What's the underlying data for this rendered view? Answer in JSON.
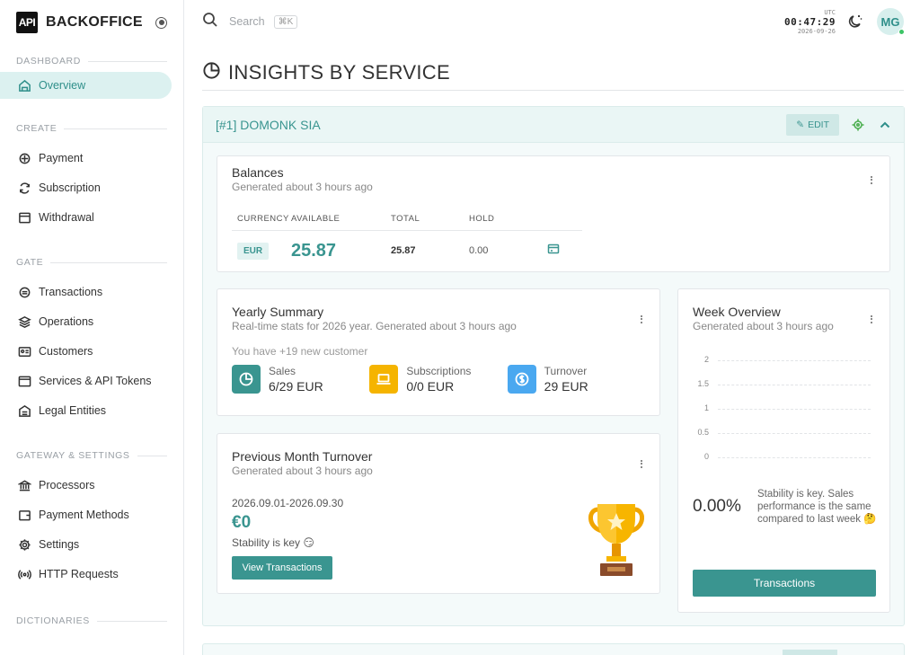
{
  "brand": {
    "logo": "API",
    "name": "BACKOFFICE"
  },
  "sidebar": {
    "sections": [
      {
        "label": "DASHBOARD",
        "items": [
          {
            "label": "Overview",
            "icon": "home-icon",
            "active": true
          }
        ]
      },
      {
        "label": "CREATE",
        "items": [
          {
            "label": "Payment",
            "icon": "payment-icon"
          },
          {
            "label": "Subscription",
            "icon": "refresh-icon"
          },
          {
            "label": "Withdrawal",
            "icon": "withdrawal-icon"
          }
        ]
      },
      {
        "label": "GATE",
        "items": [
          {
            "label": "Transactions",
            "icon": "transactions-icon"
          },
          {
            "label": "Operations",
            "icon": "layers-icon"
          },
          {
            "label": "Customers",
            "icon": "id-card-icon"
          },
          {
            "label": "Services & API Tokens",
            "icon": "browser-icon"
          },
          {
            "label": "Legal Entities",
            "icon": "building-icon"
          }
        ]
      },
      {
        "label": "GATEWAY & SETTINGS",
        "items": [
          {
            "label": "Processors",
            "icon": "bank-icon"
          },
          {
            "label": "Payment Methods",
            "icon": "wallet-icon"
          },
          {
            "label": "Settings",
            "icon": "gear-icon"
          },
          {
            "label": "HTTP Requests",
            "icon": "broadcast-icon"
          }
        ]
      },
      {
        "label": "DICTIONARIES",
        "items": []
      }
    ]
  },
  "topbar": {
    "search_placeholder": "Search",
    "search_shortcut": "⌘K",
    "clock_zone": "UTC",
    "clock_time": "00:47:29",
    "clock_date": "2026-09-26",
    "avatar_initials": "MG"
  },
  "page": {
    "title": "INSIGHTS BY SERVICE"
  },
  "service": {
    "name": "[#1] DOMONK SIA",
    "edit_label": "EDIT"
  },
  "balances": {
    "title": "Balances",
    "subtitle": "Generated about 3 hours ago",
    "columns": [
      "CURRENCY",
      "AVAILABLE",
      "TOTAL",
      "HOLD"
    ],
    "rows": [
      {
        "currency": "EUR",
        "available": "25.87",
        "total": "25.87",
        "hold": "0.00"
      }
    ]
  },
  "yearly": {
    "title": "Yearly Summary",
    "subtitle": "Real-time stats for 2026 year. Generated about 3 hours ago",
    "note": "You have +19 new customer",
    "stats": [
      {
        "label": "Sales",
        "value": "6/29 EUR",
        "color": "#3a9590",
        "icon": "pie-chart-icon"
      },
      {
        "label": "Subscriptions",
        "value": "0/0 EUR",
        "color": "#f5b400",
        "icon": "laptop-icon"
      },
      {
        "label": "Turnover",
        "value": "29 EUR",
        "color": "#4aa8f0",
        "icon": "dollar-icon"
      }
    ]
  },
  "prev_month": {
    "title": "Previous Month Turnover",
    "subtitle": "Generated about 3 hours ago",
    "range": "2026.09.01-2026.09.30",
    "amount": "€0",
    "note": "Stability is key 😏",
    "button": "View Transactions"
  },
  "week": {
    "title": "Week Overview",
    "subtitle": "Generated about 3 hours ago",
    "y_ticks": [
      "2",
      "1.5",
      "1",
      "0.5",
      "0"
    ],
    "percent": "0.00%",
    "note": "Stability is key. Sales performance is the same compared to last week 🤔",
    "button": "Transactions"
  },
  "colors": {
    "accent": "#3a9590",
    "active_bg": "#dcf1f0"
  }
}
